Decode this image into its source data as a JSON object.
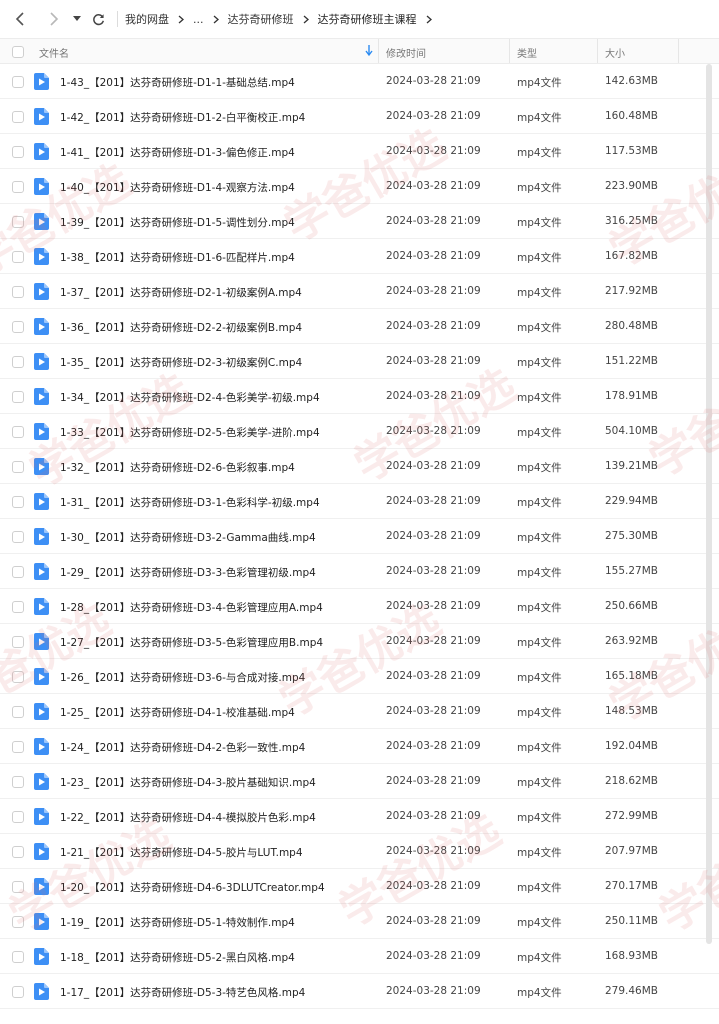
{
  "breadcrumb": [
    "我的网盘",
    "...",
    "达芬奇研修班",
    "达芬奇研修班主课程"
  ],
  "columns": {
    "name": "文件名",
    "mtime": "修改时间",
    "type": "类型",
    "size": "大小"
  },
  "files": [
    {
      "name": "1-43_【201】达芬奇研修班-D1-1-基础总结.mp4",
      "mtime": "2024-03-28 21:09",
      "type": "mp4文件",
      "size": "142.63MB"
    },
    {
      "name": "1-42_【201】达芬奇研修班-D1-2-白平衡校正.mp4",
      "mtime": "2024-03-28 21:09",
      "type": "mp4文件",
      "size": "160.48MB"
    },
    {
      "name": "1-41_【201】达芬奇研修班-D1-3-偏色修正.mp4",
      "mtime": "2024-03-28 21:09",
      "type": "mp4文件",
      "size": "117.53MB"
    },
    {
      "name": "1-40_【201】达芬奇研修班-D1-4-观察方法.mp4",
      "mtime": "2024-03-28 21:09",
      "type": "mp4文件",
      "size": "223.90MB"
    },
    {
      "name": "1-39_【201】达芬奇研修班-D1-5-调性划分.mp4",
      "mtime": "2024-03-28 21:09",
      "type": "mp4文件",
      "size": "316.25MB"
    },
    {
      "name": "1-38_【201】达芬奇研修班-D1-6-匹配样片.mp4",
      "mtime": "2024-03-28 21:09",
      "type": "mp4文件",
      "size": "167.82MB"
    },
    {
      "name": "1-37_【201】达芬奇研修班-D2-1-初级案例A.mp4",
      "mtime": "2024-03-28 21:09",
      "type": "mp4文件",
      "size": "217.92MB"
    },
    {
      "name": "1-36_【201】达芬奇研修班-D2-2-初级案例B.mp4",
      "mtime": "2024-03-28 21:09",
      "type": "mp4文件",
      "size": "280.48MB"
    },
    {
      "name": "1-35_【201】达芬奇研修班-D2-3-初级案例C.mp4",
      "mtime": "2024-03-28 21:09",
      "type": "mp4文件",
      "size": "151.22MB"
    },
    {
      "name": "1-34_【201】达芬奇研修班-D2-4-色彩美学-初级.mp4",
      "mtime": "2024-03-28 21:09",
      "type": "mp4文件",
      "size": "178.91MB"
    },
    {
      "name": "1-33_【201】达芬奇研修班-D2-5-色彩美学-进阶.mp4",
      "mtime": "2024-03-28 21:09",
      "type": "mp4文件",
      "size": "504.10MB"
    },
    {
      "name": "1-32_【201】达芬奇研修班-D2-6-色彩叙事.mp4",
      "mtime": "2024-03-28 21:09",
      "type": "mp4文件",
      "size": "139.21MB"
    },
    {
      "name": "1-31_【201】达芬奇研修班-D3-1-色彩科学-初级.mp4",
      "mtime": "2024-03-28 21:09",
      "type": "mp4文件",
      "size": "229.94MB"
    },
    {
      "name": "1-30_【201】达芬奇研修班-D3-2-Gamma曲线.mp4",
      "mtime": "2024-03-28 21:09",
      "type": "mp4文件",
      "size": "275.30MB"
    },
    {
      "name": "1-29_【201】达芬奇研修班-D3-3-色彩管理初级.mp4",
      "mtime": "2024-03-28 21:09",
      "type": "mp4文件",
      "size": "155.27MB"
    },
    {
      "name": "1-28_【201】达芬奇研修班-D3-4-色彩管理应用A.mp4",
      "mtime": "2024-03-28 21:09",
      "type": "mp4文件",
      "size": "250.66MB"
    },
    {
      "name": "1-27_【201】达芬奇研修班-D3-5-色彩管理应用B.mp4",
      "mtime": "2024-03-28 21:09",
      "type": "mp4文件",
      "size": "263.92MB"
    },
    {
      "name": "1-26_【201】达芬奇研修班-D3-6-与合成对接.mp4",
      "mtime": "2024-03-28 21:09",
      "type": "mp4文件",
      "size": "165.18MB"
    },
    {
      "name": "1-25_【201】达芬奇研修班-D4-1-校准基础.mp4",
      "mtime": "2024-03-28 21:09",
      "type": "mp4文件",
      "size": "148.53MB"
    },
    {
      "name": "1-24_【201】达芬奇研修班-D4-2-色彩一致性.mp4",
      "mtime": "2024-03-28 21:09",
      "type": "mp4文件",
      "size": "192.04MB"
    },
    {
      "name": "1-23_【201】达芬奇研修班-D4-3-胶片基础知识.mp4",
      "mtime": "2024-03-28 21:09",
      "type": "mp4文件",
      "size": "218.62MB"
    },
    {
      "name": "1-22_【201】达芬奇研修班-D4-4-模拟胶片色彩.mp4",
      "mtime": "2024-03-28 21:09",
      "type": "mp4文件",
      "size": "272.99MB"
    },
    {
      "name": "1-21_【201】达芬奇研修班-D4-5-胶片与LUT.mp4",
      "mtime": "2024-03-28 21:09",
      "type": "mp4文件",
      "size": "207.97MB"
    },
    {
      "name": "1-20_【201】达芬奇研修班-D4-6-3DLUTCreator.mp4",
      "mtime": "2024-03-28 21:09",
      "type": "mp4文件",
      "size": "270.17MB"
    },
    {
      "name": "1-19_【201】达芬奇研修班-D5-1-特效制作.mp4",
      "mtime": "2024-03-28 21:09",
      "type": "mp4文件",
      "size": "250.11MB"
    },
    {
      "name": "1-18_【201】达芬奇研修班-D5-2-黑白风格.mp4",
      "mtime": "2024-03-28 21:09",
      "type": "mp4文件",
      "size": "168.93MB"
    },
    {
      "name": "1-17_【201】达芬奇研修班-D5-3-特艺色风格.mp4",
      "mtime": "2024-03-28 21:09",
      "type": "mp4文件",
      "size": "279.46MB"
    }
  ],
  "watermark": {
    "text": "学爸优选"
  },
  "icons": {
    "back": "chevron-left-icon",
    "forward": "chevron-right-icon",
    "history": "caret-down-icon",
    "refresh": "refresh-icon",
    "sort": "sort-down-arrow-icon",
    "file": "video-file-icon"
  },
  "colors": {
    "accent": "#2b8bf2",
    "icon_fill": "#3d8ff5",
    "watermark": "#e06a6a"
  }
}
